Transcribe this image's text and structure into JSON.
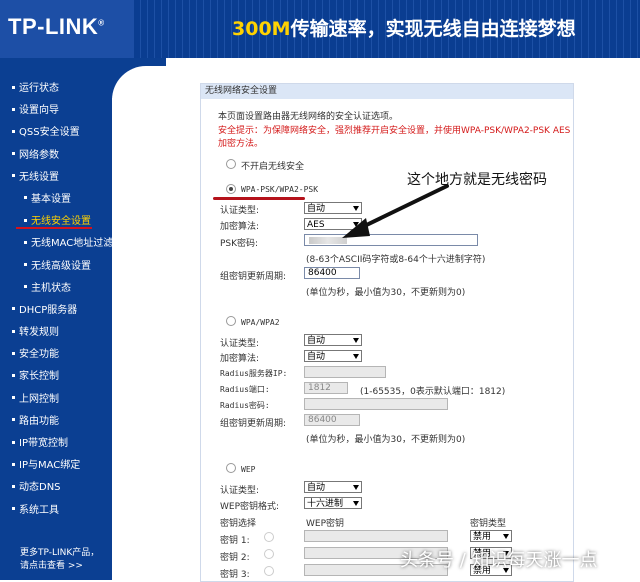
{
  "brand": {
    "logo": "TP-LINK",
    "tm": "®",
    "slogan_hl": "300M",
    "slogan_rest": "传输速率，实现无线自由连接梦想"
  },
  "sidebar": {
    "items": [
      {
        "label": "运行状态"
      },
      {
        "label": "设置向导"
      },
      {
        "label": "QSS安全设置"
      },
      {
        "label": "网络参数"
      },
      {
        "label": "无线设置"
      },
      {
        "label": "基本设置"
      },
      {
        "label": "无线安全设置"
      },
      {
        "label": "无线MAC地址过滤"
      },
      {
        "label": "无线高级设置"
      },
      {
        "label": "主机状态"
      },
      {
        "label": "DHCP服务器"
      },
      {
        "label": "转发规则"
      },
      {
        "label": "安全功能"
      },
      {
        "label": "家长控制"
      },
      {
        "label": "上网控制"
      },
      {
        "label": "路由功能"
      },
      {
        "label": "IP带宽控制"
      },
      {
        "label": "IP与MAC绑定"
      },
      {
        "label": "动态DNS"
      },
      {
        "label": "系统工具"
      }
    ],
    "footer_line1": "更多TP-LINK产品，",
    "footer_line2": "请点击查看 >>"
  },
  "panel": {
    "title": "无线网络安全设置",
    "intro": "本页面设置路由器无线网络的安全认证选项。",
    "warn1": "安全提示：为保障网络安全，强烈推荐开启安全设置，并使用WPA-PSK/WPA2-PSK AES",
    "warn2": "加密方法。",
    "opt_none": "不开启无线安全",
    "wpapsk": {
      "heading": "WPA-PSK/WPA2-PSK",
      "auth_label": "认证类型:",
      "auth_value": "自动",
      "enc_label": "加密算法:",
      "enc_value": "AES",
      "psk_label": "PSK密码:",
      "psk_hint": "(8-63个ASCII码字符或8-64个十六进制字符)",
      "renew_label": "组密钥更新周期:",
      "renew_value": "86400",
      "renew_hint": "(单位为秒，最小值为30，不更新则为0)"
    },
    "wpa": {
      "heading": "WPA/WPA2",
      "auth_label": "认证类型:",
      "auth_value": "自动",
      "enc_label": "加密算法:",
      "enc_value": "自动",
      "radius_ip_label": "Radius服务器IP:",
      "radius_port_label": "Radius端口:",
      "radius_port_value": "1812",
      "radius_port_hint": "(1-65535，0表示默认端口：1812)",
      "radius_pwd_label": "Radius密码:",
      "renew_label": "组密钥更新周期:",
      "renew_value": "86400",
      "renew_hint": "(单位为秒，最小值为30，不更新则为0)"
    },
    "wep": {
      "heading": "WEP",
      "auth_label": "认证类型:",
      "auth_value": "自动",
      "fmt_label": "WEP密钥格式:",
      "fmt_value": "十六进制",
      "col_select": "密钥选择",
      "col_key": "WEP密钥",
      "col_type": "密钥类型",
      "keys": [
        {
          "label": "密钥 1:",
          "type": "禁用"
        },
        {
          "label": "密钥 2:",
          "type": "禁用"
        },
        {
          "label": "密钥 3:",
          "type": "禁用"
        }
      ]
    }
  },
  "annotation": "这个地方就是无线密码",
  "watermark": "头条号 / 知识每天涨一点",
  "colors": {
    "sidebar": "#0b3f92",
    "active": "#ffd200",
    "annotation_line": "#b5121b"
  }
}
